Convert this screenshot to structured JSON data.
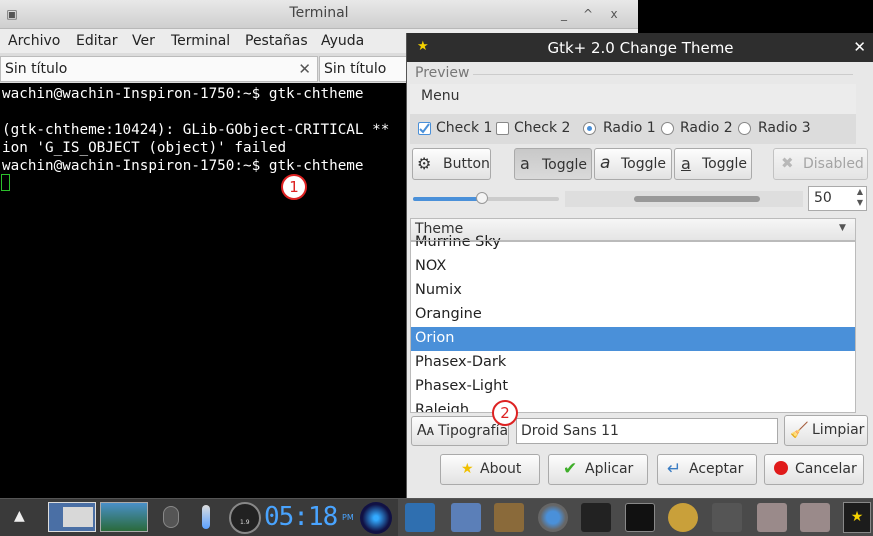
{
  "terminal": {
    "title": "Terminal",
    "controls": {
      "minimize": "_",
      "maximize": "^",
      "close": "x"
    },
    "menu": [
      "Archivo",
      "Editar",
      "Ver",
      "Terminal",
      "Pestañas",
      "Ayuda"
    ],
    "tabs": [
      {
        "label": "Sin título",
        "close": "✕"
      },
      {
        "label": "Sin título"
      }
    ],
    "lines": [
      "wachin@wachin-Inspiron-1750:~$ gtk-chtheme",
      "",
      "(gtk-chtheme:10424): GLib-GObject-CRITICAL **",
      "ion 'G_IS_OBJECT (object)' failed",
      "wachin@wachin-Inspiron-1750:~$ gtk-chtheme"
    ]
  },
  "annotations": {
    "one": "1",
    "two": "2"
  },
  "gtk": {
    "title": "Gtk+ 2.0 Change Theme",
    "close": "✕",
    "preview_label": "Preview",
    "menu_label": "Menu",
    "check1": "Check 1",
    "check2": "Check 2",
    "radio1": "Radio 1",
    "radio2": "Radio 2",
    "radio3": "Radio 3",
    "button": "Button",
    "toggle": "Toggle",
    "disabled": "Disabled",
    "spin_value": "50",
    "slider_fraction": 0.28,
    "theme_header": "Theme",
    "themes": [
      "Murrine Sky",
      "NOX",
      "Numix",
      "Orangine",
      "Orion",
      "Phasex-Dark",
      "Phasex-Light",
      "Raleigh"
    ],
    "selected_theme": "Orion",
    "font_button": "Tipografía",
    "font_value": "Droid Sans 11",
    "clear_button": "Limpiar",
    "about": "About",
    "apply": "Aplicar",
    "accept": "Aceptar",
    "cancel": "Cancelar"
  },
  "taskbar": {
    "clock": "05:18",
    "ampm": "PM",
    "meter_value": "1.9"
  },
  "colors": {
    "selection": "#4a90d9",
    "badge": "#dd2222",
    "clock": "#49a4ff"
  }
}
